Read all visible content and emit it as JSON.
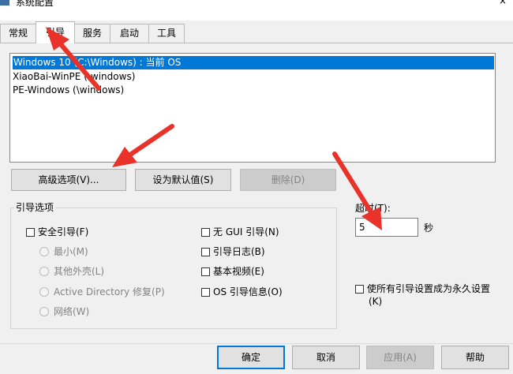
{
  "window": {
    "title": "系统配置",
    "close_glyph": "×"
  },
  "tabs": [
    {
      "label": "常规"
    },
    {
      "label": "引导"
    },
    {
      "label": "服务"
    },
    {
      "label": "启动"
    },
    {
      "label": "工具"
    }
  ],
  "os_list": [
    {
      "label": "Windows 10 (C:\\Windows) : 当前 OS",
      "selected": true
    },
    {
      "label": "XiaoBai-WinPE (\\windows)",
      "selected": false
    },
    {
      "label": "PE-Windows (\\windows)",
      "selected": false
    }
  ],
  "buttons": {
    "advanced": "高级选项(V)...",
    "set_default": "设为默认值(S)",
    "delete": "删除(D)"
  },
  "boot_options": {
    "group_label": "引导选项",
    "safe_boot": "安全引导(F)",
    "radios": [
      "最小(M)",
      "其他外壳(L)",
      "Active Directory 修复(P)",
      "网络(W)"
    ],
    "no_gui": "无 GUI 引导(N)",
    "boot_log": "引导日志(B)",
    "base_video": "基本视频(E)",
    "os_boot_info": "OS 引导信息(O)"
  },
  "timeout": {
    "label": "超时(T):",
    "value": "5",
    "unit": "秒"
  },
  "permanent": {
    "line1": "使所有引导设置成为永久设置",
    "line2": "(K)"
  },
  "footer": {
    "ok": "确定",
    "cancel": "取消",
    "apply": "应用(A)",
    "help": "帮助"
  },
  "colors": {
    "selection": "#0078d7",
    "annotation": "#e8322a"
  }
}
